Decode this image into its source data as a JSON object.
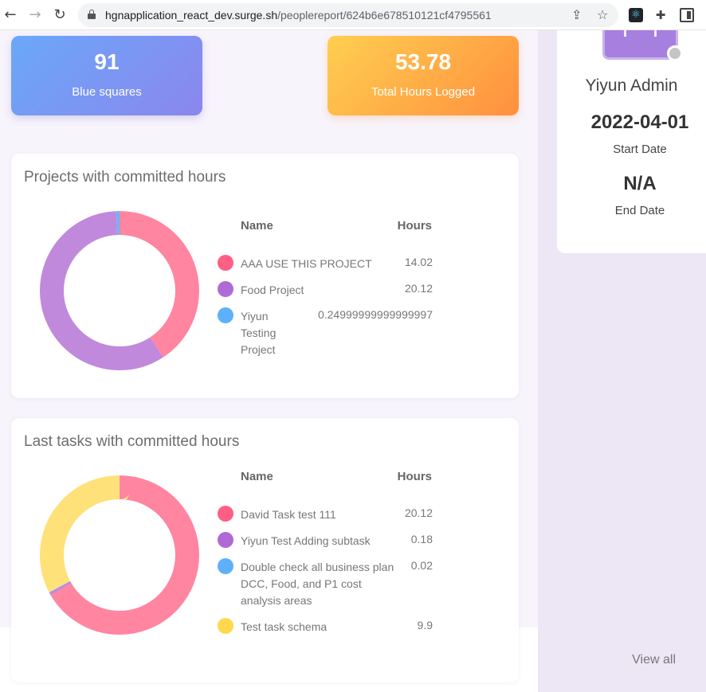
{
  "browser": {
    "url_host": "hgnapplication_react_dev.surge.sh",
    "url_path": "/peoplereport/624b6e678510121cf4795561"
  },
  "stats": [
    {
      "value": "91",
      "label": "Blue squares"
    },
    {
      "value": "53.78",
      "label": "Total Hours Logged"
    }
  ],
  "projects_card": {
    "title": "Projects with committed hours",
    "col_name": "Name",
    "col_hours": "Hours",
    "rows": [
      {
        "name": "AAA USE THIS PROJECT",
        "hours": "14.02",
        "color": "#ff5f85"
      },
      {
        "name": "Food Project",
        "hours": "20.12",
        "color": "#b06ad6"
      },
      {
        "name": "Yiyun Testing Project",
        "hours": "0.24999999999999997",
        "color": "#5eb0fb"
      }
    ]
  },
  "tasks_card": {
    "title": "Last tasks with committed hours",
    "col_name": "Name",
    "col_hours": "Hours",
    "rows": [
      {
        "name": "David Task test 111",
        "hours": "20.12",
        "color": "#ff5f85"
      },
      {
        "name": "Yiyun Test Adding subtask",
        "hours": "0.18",
        "color": "#b06ad6"
      },
      {
        "name": "Double check all business plan DCC, Food, and P1 cost analysis areas",
        "hours": "0.02",
        "color": "#5eb0fb"
      },
      {
        "name": "Test task schema",
        "hours": "9.9",
        "color": "#ffd84d"
      }
    ],
    "view_all": "View all"
  },
  "profile": {
    "name": "Yiyun Admin",
    "start_date": "2022-04-01",
    "start_label": "Start Date",
    "end_date": "N/A",
    "end_label": "End Date"
  },
  "chart_data": [
    {
      "type": "pie",
      "categories": [
        "AAA USE THIS PROJECT",
        "Food Project",
        "Yiyun Testing Project"
      ],
      "values": [
        14.02,
        20.12,
        0.25
      ],
      "colors": [
        "#ff85a0",
        "#c089dc",
        "#6eb5f7"
      ]
    },
    {
      "type": "pie",
      "categories": [
        "David Task test 111",
        "Yiyun Test Adding subtask",
        "Double check all business plan DCC, Food, and P1 cost analysis areas",
        "Test task schema"
      ],
      "values": [
        20.12,
        0.18,
        0.02,
        9.9
      ],
      "colors": [
        "#ff85a0",
        "#c089dc",
        "#6eb5f7",
        "#ffe17a"
      ]
    }
  ]
}
